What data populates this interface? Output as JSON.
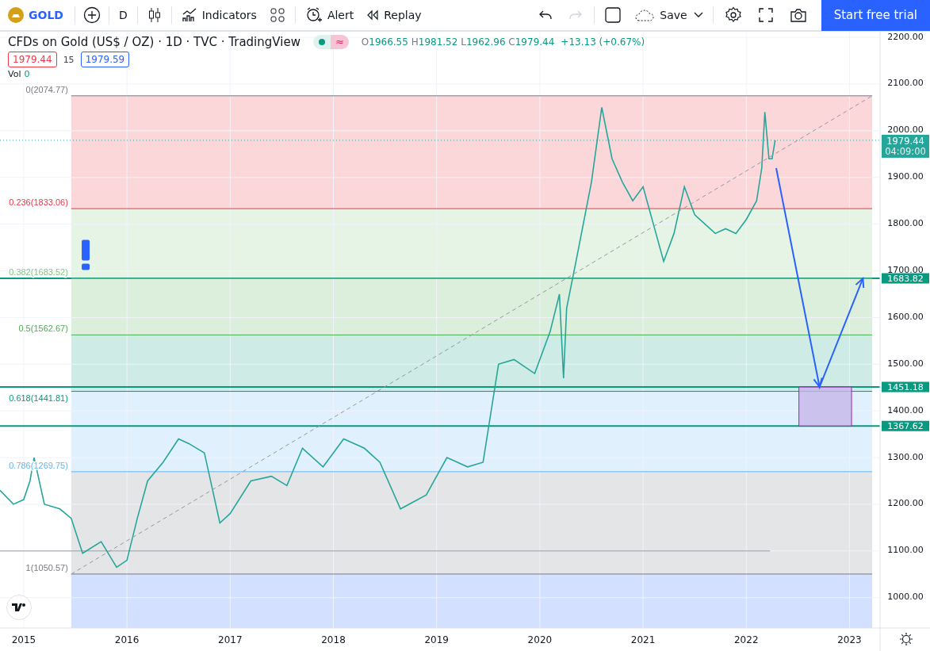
{
  "toolbar": {
    "symbol": "GOLD",
    "interval": "D",
    "indicators": "Indicators",
    "alert": "Alert",
    "replay": "Replay",
    "save": "Save",
    "redo_disabled": true,
    "trial_button": "Start free trial"
  },
  "legend": {
    "title": "CFDs on Gold (US$ / OZ) · 1D · TVC · TradingView",
    "badge": "≈",
    "ohlc": [
      {
        "label": "O",
        "value": "1966.55"
      },
      {
        "label": "H",
        "value": "1981.52"
      },
      {
        "label": "L",
        "value": "1962.96"
      },
      {
        "label": "C",
        "value": "1979.44"
      }
    ],
    "change": "+13.13 (+0.67%)",
    "sell": "1979.44",
    "spread": "15",
    "buy": "1979.59",
    "volume_label": "Vol",
    "volume": "0"
  },
  "countdown": "04:09:00",
  "chart_data": {
    "type": "line",
    "grid": true,
    "x": [
      2014.77,
      2014.9,
      2015.0,
      2015.06,
      2015.1,
      2015.2,
      2015.35,
      2015.46,
      2015.57,
      2015.75,
      2015.9,
      2016.0,
      2016.1,
      2016.2,
      2016.35,
      2016.5,
      2016.6,
      2016.75,
      2016.9,
      2017.0,
      2017.2,
      2017.4,
      2017.55,
      2017.7,
      2017.9,
      2018.1,
      2018.3,
      2018.45,
      2018.65,
      2018.9,
      2019.1,
      2019.3,
      2019.45,
      2019.6,
      2019.75,
      2019.95,
      2020.1,
      2020.19,
      2020.23,
      2020.26,
      2020.35,
      2020.5,
      2020.6,
      2020.7,
      2020.8,
      2020.9,
      2021.0,
      2021.1,
      2021.2,
      2021.3,
      2021.4,
      2021.5,
      2021.6,
      2021.7,
      2021.8,
      2021.9,
      2022.0,
      2022.1,
      2022.15,
      2022.18,
      2022.22,
      2022.25,
      2022.28
    ],
    "series": [
      {
        "color": "#26a69a",
        "values": [
          1230,
          1200,
          1210,
          1250,
          1300,
          1200,
          1190,
          1170,
          1095,
          1120,
          1065,
          1080,
          1170,
          1250,
          1290,
          1340,
          1330,
          1310,
          1160,
          1180,
          1250,
          1260,
          1240,
          1320,
          1280,
          1340,
          1320,
          1290,
          1190,
          1220,
          1300,
          1280,
          1290,
          1500,
          1510,
          1480,
          1570,
          1650,
          1470,
          1620,
          1720,
          1890,
          2050,
          1940,
          1890,
          1850,
          1880,
          1800,
          1720,
          1780,
          1880,
          1820,
          1800,
          1780,
          1790,
          1780,
          1810,
          1850,
          1920,
          2040,
          1940,
          1940,
          1979.44
        ]
      }
    ],
    "xlim": [
      2014.77,
      2023.78
    ],
    "ylim": [
      935,
      2212
    ],
    "xticks": [
      {
        "value": 2015,
        "label": "2015"
      },
      {
        "value": 2016,
        "label": "2016"
      },
      {
        "value": 2017,
        "label": "2017"
      },
      {
        "value": 2018,
        "label": "2018"
      },
      {
        "value": 2019,
        "label": "2019"
      },
      {
        "value": 2020,
        "label": "2020"
      },
      {
        "value": 2021,
        "label": "2021"
      },
      {
        "value": 2022,
        "label": "2022"
      },
      {
        "value": 2023,
        "label": "2023"
      }
    ],
    "yticks": [
      {
        "value": 1000,
        "label": "1000.00"
      },
      {
        "value": 1100,
        "label": "1100.00"
      },
      {
        "value": 1200,
        "label": "1200.00"
      },
      {
        "value": 1300,
        "label": "1300.00"
      },
      {
        "value": 1400,
        "label": "1400.00"
      },
      {
        "value": 1500,
        "label": "1500.00"
      },
      {
        "value": 1600,
        "label": "1600.00"
      },
      {
        "value": 1700,
        "label": "1700.00"
      },
      {
        "value": 1800,
        "label": "1800.00"
      },
      {
        "value": 1900,
        "label": "1900.00"
      },
      {
        "value": 2000,
        "label": "2000.00"
      },
      {
        "value": 2100,
        "label": "2100.00"
      },
      {
        "value": 2200,
        "label": "2200.00"
      }
    ],
    "bands": [
      {
        "axis": "y",
        "from": 1833.06,
        "to": 2074.77,
        "color": "#f23645"
      },
      {
        "axis": "y",
        "from": 1683.52,
        "to": 1833.06,
        "color": "#81c784"
      },
      {
        "axis": "y",
        "from": 1562.67,
        "to": 1683.52,
        "color": "#4caf50"
      },
      {
        "axis": "y",
        "from": 1441.81,
        "to": 1562.67,
        "color": "#089981"
      },
      {
        "axis": "y",
        "from": 1269.75,
        "to": 1441.81,
        "color": "#64b5f6"
      },
      {
        "axis": "y",
        "from": 1050.57,
        "to": 1269.75,
        "color": "#787b86"
      },
      {
        "axis": "y",
        "from": 935,
        "to": 1050.57,
        "color": "#2962ff"
      }
    ],
    "ref_lines": [
      {
        "axis": "y",
        "value": 2074.77,
        "label": "0(2074.77)",
        "color": "#787b86"
      },
      {
        "axis": "y",
        "value": 1979.44,
        "label": "1979.44",
        "color": "#26a69a"
      },
      {
        "axis": "y",
        "value": 1833.06,
        "label": "0.236(1833.06)",
        "color": "#f23645"
      },
      {
        "axis": "y",
        "value": 1683.82,
        "label": "1683.82",
        "color": "#089981"
      },
      {
        "axis": "y",
        "value": 1683.52,
        "label": "0.382(1683.52)",
        "color": "#81c784"
      },
      {
        "axis": "y",
        "value": 1562.67,
        "label": "0.5(1562.67)",
        "color": "#4caf50"
      },
      {
        "axis": "y",
        "value": 1451.18,
        "label": "1451.18",
        "color": "#089981"
      },
      {
        "axis": "y",
        "value": 1441.81,
        "label": "0.618(1441.81)",
        "color": "#089981"
      },
      {
        "axis": "y",
        "value": 1367.62,
        "label": "1367.62",
        "color": "#089981"
      },
      {
        "axis": "y",
        "value": 1269.75,
        "label": "0.786(1269.75)",
        "color": "#64b5f6"
      },
      {
        "axis": "y",
        "value": 1100,
        "color": "#9598a1"
      },
      {
        "axis": "y",
        "value": 1050.57,
        "label": "1(1050.57)",
        "color": "#787b86"
      }
    ]
  }
}
